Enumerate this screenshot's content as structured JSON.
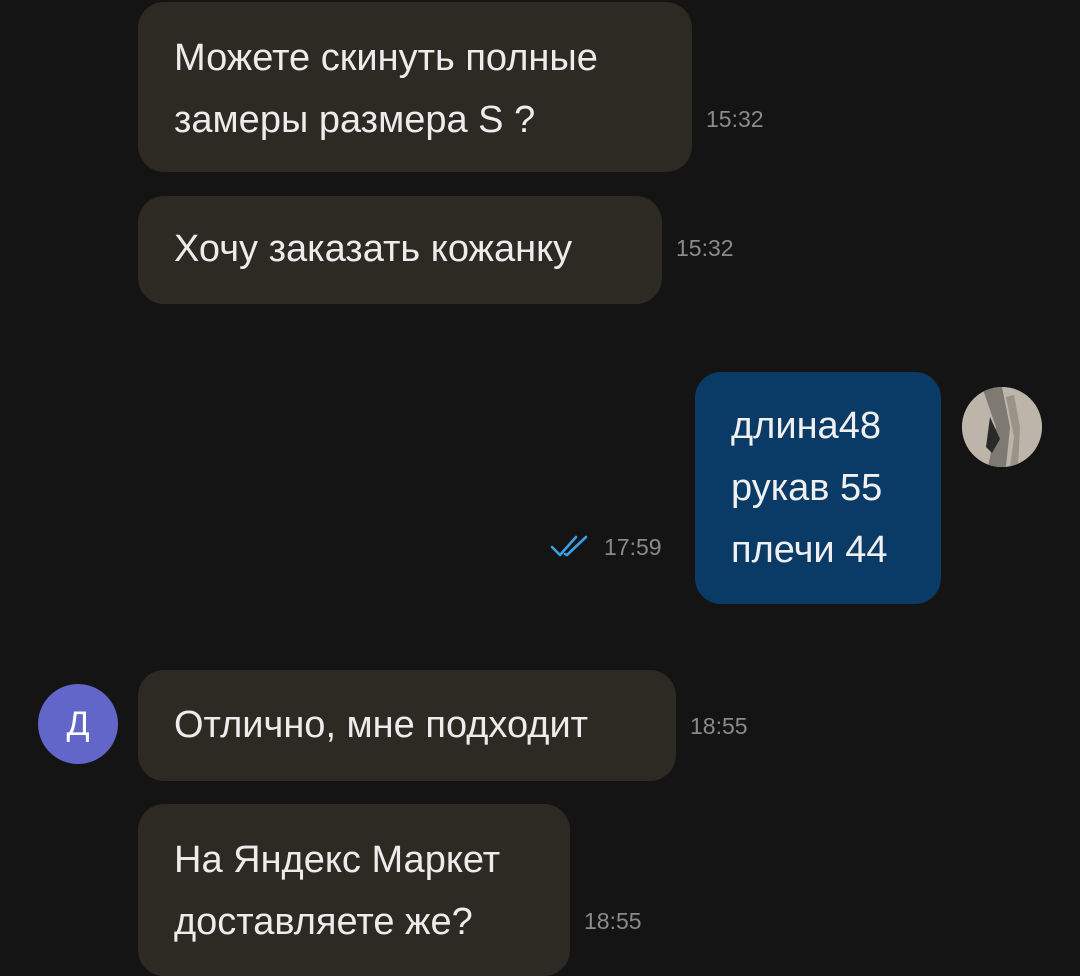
{
  "colors": {
    "background": "#141414",
    "incoming_bubble": "#2c2a22",
    "outgoing_bubble": "#0a3a66",
    "avatar_letter_bg": "#6366c9",
    "read_check": "#3b9fe8",
    "timestamp": "#8a8a8a"
  },
  "messages": [
    {
      "direction": "incoming",
      "lines": [
        "Можете скинуть полные",
        "замеры размера S ?"
      ],
      "time": "15:32"
    },
    {
      "direction": "incoming",
      "lines": [
        "Хочу заказать кожанку"
      ],
      "time": "15:32"
    },
    {
      "direction": "outgoing",
      "lines": [
        "длина48",
        "рукав 55",
        "плечи 44"
      ],
      "time": "17:59",
      "status_icon": "double-check-read-icon",
      "avatar_icon": "user-photo-avatar"
    },
    {
      "direction": "incoming",
      "lines": [
        "Отлично, мне подходит"
      ],
      "time": "18:55",
      "avatar_letter": "Д"
    },
    {
      "direction": "incoming",
      "lines": [
        "На Яндекс Маркет",
        "доставляете же?"
      ],
      "time": "18:55"
    }
  ]
}
